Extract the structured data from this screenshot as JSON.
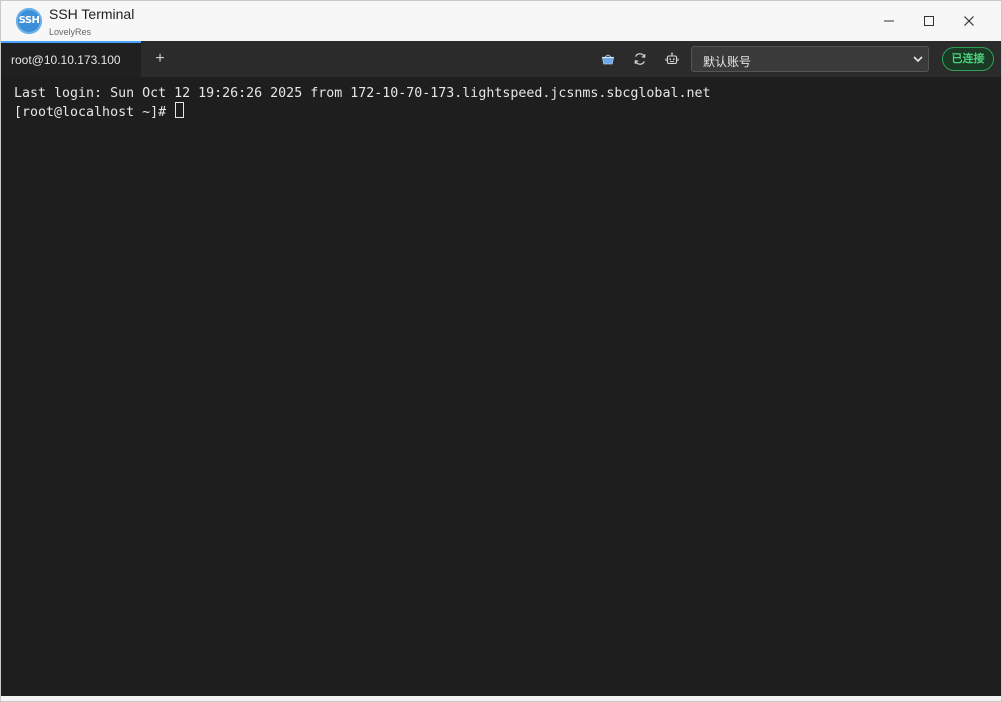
{
  "window": {
    "title": "SSH Terminal",
    "subtitle": "LovelyRes",
    "logo_text": "SSH"
  },
  "tabs": [
    {
      "label": "root@10.10.173.100",
      "active": true
    }
  ],
  "tab_add_label": "+",
  "toolbar": {
    "icons": [
      "basket-icon",
      "refresh-icon",
      "robot-icon"
    ],
    "account_select": {
      "selected": "默认账号"
    },
    "status_badge": "已连接"
  },
  "terminal": {
    "lines": [
      "Last login: Sun Oct 12 19:26:26 2025 from 172-10-70-173.lightspeed.jcsnms.sbcglobal.net",
      "[root@localhost ~]# "
    ]
  },
  "colors": {
    "terminal_bg": "#1e1e1e",
    "tab_accent": "#4aa3ff",
    "status_green": "#4cd07a"
  }
}
